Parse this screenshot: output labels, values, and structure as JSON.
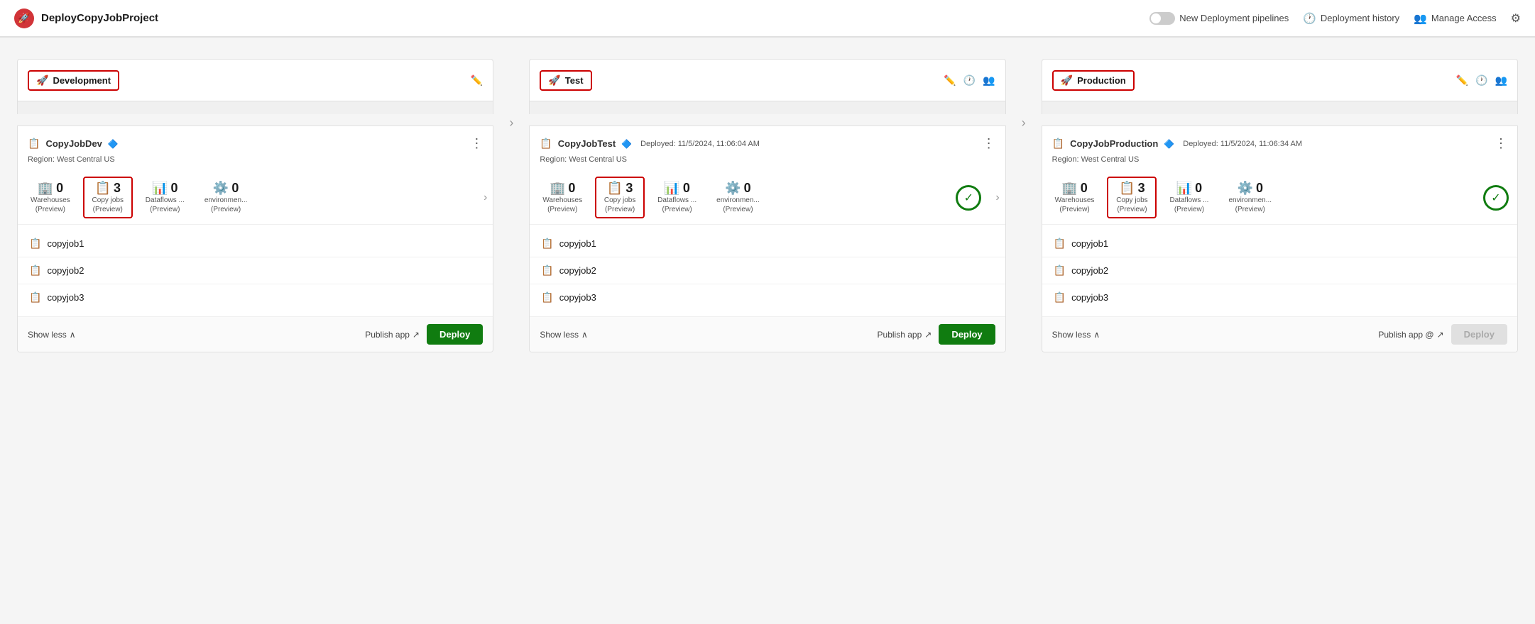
{
  "header": {
    "title": "DeployCopyJobProject",
    "logo_char": "🚀",
    "actions": {
      "new_deployment": "New Deployment pipelines",
      "deployment_history": "Deployment history",
      "manage_access": "Manage Access"
    }
  },
  "stages": [
    {
      "id": "development",
      "name": "Development",
      "card_title": "CopyJobDev",
      "deployed": "",
      "region": "Region: West Central US",
      "metrics": [
        {
          "icon": "🏢",
          "num": "0",
          "label": "Warehouses\n(Preview)",
          "highlighted": false
        },
        {
          "icon": "📋",
          "num": "3",
          "label": "Copy jobs\n(Preview)",
          "highlighted": true
        },
        {
          "icon": "📊",
          "num": "0",
          "label": "Dataflows ...\n(Preview)",
          "highlighted": false
        },
        {
          "icon": "⚙️",
          "num": "0",
          "label": "environmen...\n(Preview)",
          "highlighted": false
        }
      ],
      "items": [
        "copyjob1",
        "copyjob2",
        "copyjob3"
      ],
      "show_less": "Show less",
      "publish_app": "Publish app",
      "deploy_label": "Deploy",
      "deploy_disabled": false,
      "has_check": false,
      "has_arrow_right": true
    },
    {
      "id": "test",
      "name": "Test",
      "card_title": "CopyJobTest",
      "deployed": "Deployed: 11/5/2024, 11:06:04 AM",
      "region": "Region: West Central US",
      "metrics": [
        {
          "icon": "🏢",
          "num": "0",
          "label": "Warehouses\n(Preview)",
          "highlighted": false
        },
        {
          "icon": "📋",
          "num": "3",
          "label": "Copy jobs\n(Preview)",
          "highlighted": true
        },
        {
          "icon": "📊",
          "num": "0",
          "label": "Dataflows ...\n(Preview)",
          "highlighted": false
        },
        {
          "icon": "⚙️",
          "num": "0",
          "label": "environmen...\n(Preview)",
          "highlighted": false
        }
      ],
      "items": [
        "copyjob1",
        "copyjob2",
        "copyjob3"
      ],
      "show_less": "Show less",
      "publish_app": "Publish app",
      "deploy_label": "Deploy",
      "deploy_disabled": false,
      "has_check": true,
      "has_arrow_right": true
    },
    {
      "id": "production",
      "name": "Production",
      "card_title": "CopyJobProduction",
      "deployed": "Deployed: 11/5/2024, 11:06:34 AM",
      "region": "Region: West Central US",
      "metrics": [
        {
          "icon": "🏢",
          "num": "0",
          "label": "Warehouses\n(Preview)",
          "highlighted": false
        },
        {
          "icon": "📋",
          "num": "3",
          "label": "Copy jobs\n(Preview)",
          "highlighted": true
        },
        {
          "icon": "📊",
          "num": "0",
          "label": "Dataflows ...\n(Preview)",
          "highlighted": false
        },
        {
          "icon": "⚙️",
          "num": "0",
          "label": "environmen...\n(Preview)",
          "highlighted": false
        }
      ],
      "items": [
        "copyjob1",
        "copyjob2",
        "copyjob3"
      ],
      "show_less": "Show less",
      "publish_app": "Publish app @",
      "deploy_label": "Deploy",
      "deploy_disabled": true,
      "has_check": true,
      "has_arrow_right": false
    }
  ]
}
